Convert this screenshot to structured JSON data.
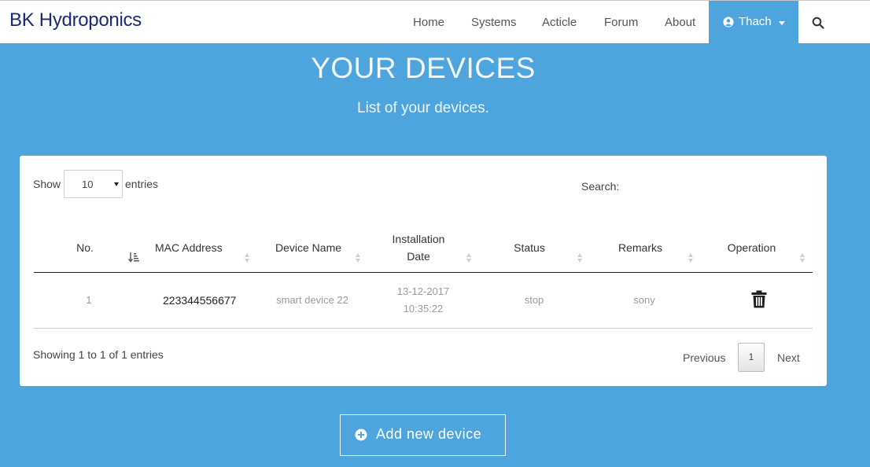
{
  "navbar": {
    "brand": "BK Hydroponics",
    "links": [
      "Home",
      "Systems",
      "Acticle",
      "Forum",
      "About"
    ],
    "user": "Thach"
  },
  "header": {
    "title": "YOUR DEVICES",
    "subtitle": "List of your devices."
  },
  "table_controls": {
    "show_label": "Show",
    "page_length": "10",
    "entries_label": "entries",
    "search_label": "Search:"
  },
  "table": {
    "columns": [
      "No.",
      "MAC Address",
      "Device Name",
      "Installation Date",
      "Status",
      "Remarks",
      "Operation"
    ],
    "rows": [
      {
        "no": "1",
        "mac": "223344556677",
        "name": "smart device 22",
        "date": "13-12-2017",
        "time": "10:35:22",
        "status": "stop",
        "remarks": "sony",
        "operation_icon": "trash-icon"
      }
    ]
  },
  "footer": {
    "info": "Showing 1 to 1 of 1 entries",
    "previous": "Previous",
    "page": "1",
    "next": "Next"
  },
  "add_button": {
    "label": "Add new device",
    "icon": "plus-circle-icon"
  },
  "colors": {
    "page_bg": "#4ea4dd",
    "brand": "#1b2a73",
    "card_bg": "#ffffff"
  }
}
